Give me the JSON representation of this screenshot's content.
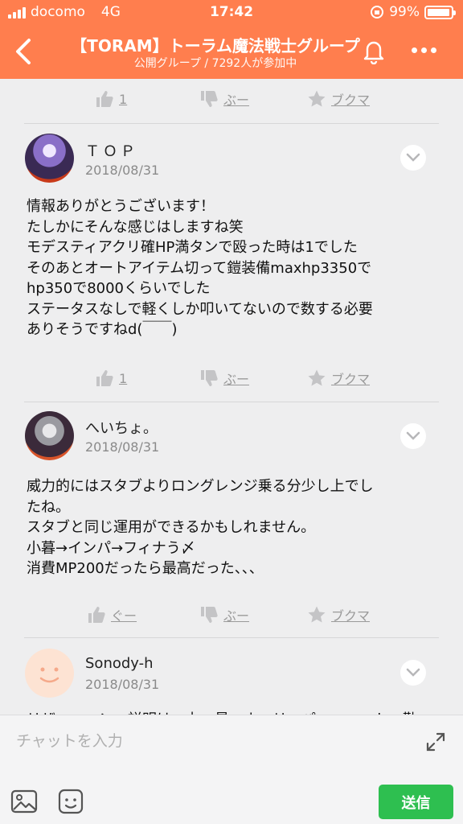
{
  "status": {
    "carrier": "docomo",
    "network": "4G",
    "time": "17:42",
    "battery": "99%"
  },
  "header": {
    "title": "【TORAM】トーラム魔法戦士グループ",
    "subtitle": "公開グループ / 7292人が参加中"
  },
  "actions": [
    {
      "like": "1",
      "boo": "ぶー",
      "bookmark": "ブクマ"
    },
    {
      "like": "1",
      "boo": "ぶー",
      "bookmark": "ブクマ"
    },
    {
      "like": "ぐー",
      "boo": "ぶー",
      "bookmark": "ブクマ"
    }
  ],
  "posts": [
    {
      "name": "ＴＯＰ",
      "date": "2018/08/31",
      "lines": [
        "情報ありがとうございます！",
        "たしかにそんな感じはしますね笑",
        "モデスティアクリ確HP満タンで殴った時は1でした",
        "そのあとオートアイテム切って鎧装備maxhp3350で",
        "hp350で8000くらいでした",
        "ステータスなしで軽くしか叩いてないので数する必要",
        "ありそうですねd(￣￣)"
      ]
    },
    {
      "name": "へいちょ。",
      "date": "2018/08/31",
      "lines": [
        "威力的にはスタブよりロングレンジ乗る分少し上でし",
        "たね。",
        "スタブと同じ運用ができるかもしれません。",
        "小暮→インパ→フィナう〆",
        "消費MP200だったら最高だった、、、"
      ]
    },
    {
      "name": "Sonody-h",
      "date": "2018/08/31",
      "partial": "リザ…ー…ン…説明は…力…最…ホ…リ…パ…ー……ト…勤…"
    }
  ],
  "chat": {
    "placeholder": "チャットを入力",
    "send": "送信"
  },
  "colors": {
    "header": "#ff7e4e",
    "send": "#2ebf50"
  }
}
